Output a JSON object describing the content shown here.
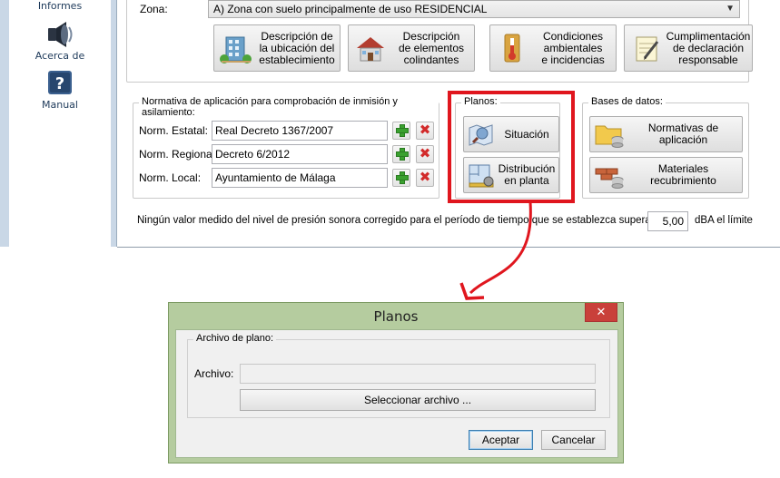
{
  "sidebar": {
    "items": [
      {
        "label": "Informes",
        "icon": "informes-icon"
      },
      {
        "label": "Acerca de",
        "icon": "speaker-icon"
      },
      {
        "label": "Manual",
        "icon": "help-icon"
      }
    ]
  },
  "zona": {
    "label": "Zona:",
    "selected": "A) Zona con suelo principalmente de uso RESIDENCIAL"
  },
  "action_buttons": [
    {
      "label": "Descripción de\nla ubicación del\nestablecimiento",
      "icon": "building-icon"
    },
    {
      "label": "Descripción\nde elementos\ncolindantes",
      "icon": "house-icon"
    },
    {
      "label": "Condiciones\nambientales\ne incidencias",
      "icon": "thermometer-icon"
    },
    {
      "label": "Cumplimentación\nde declaración\nresponsable",
      "icon": "notepad-icon"
    }
  ],
  "normativa": {
    "title": "Normativa de aplicación para comprobación de inmisión y asilamiento:",
    "rows": [
      {
        "label": "Norm. Estatal:",
        "value": "Real Decreto 1367/2007"
      },
      {
        "label": "Norm. Regional:",
        "value": "Decreto 6/2012"
      },
      {
        "label": "Norm. Local:",
        "value": "Ayuntamiento de Málaga"
      }
    ]
  },
  "planos": {
    "title": "Planos:",
    "situacion": "Situación",
    "distribucion": "Distribución\nen planta"
  },
  "bases": {
    "title": "Bases de datos:",
    "normativas": "Normativas de aplicación",
    "materiales": "Materiales recubrimiento"
  },
  "footer": {
    "text": "Ningún valor medido del nivel de presión sonora corregido para el período de tiempo que se establezca superará en",
    "value": "5,00",
    "suffix": "dBA el límite"
  },
  "colors": {
    "highlight": "#e0161e",
    "arrow": "#e0161e"
  },
  "dialog": {
    "title": "Planos",
    "close_glyph": "✕",
    "group_title": "Archivo de plano:",
    "archivo_label": "Archivo:",
    "archivo_value": "",
    "select_button": "Seleccionar archivo ...",
    "ok": "Aceptar",
    "cancel": "Cancelar"
  }
}
